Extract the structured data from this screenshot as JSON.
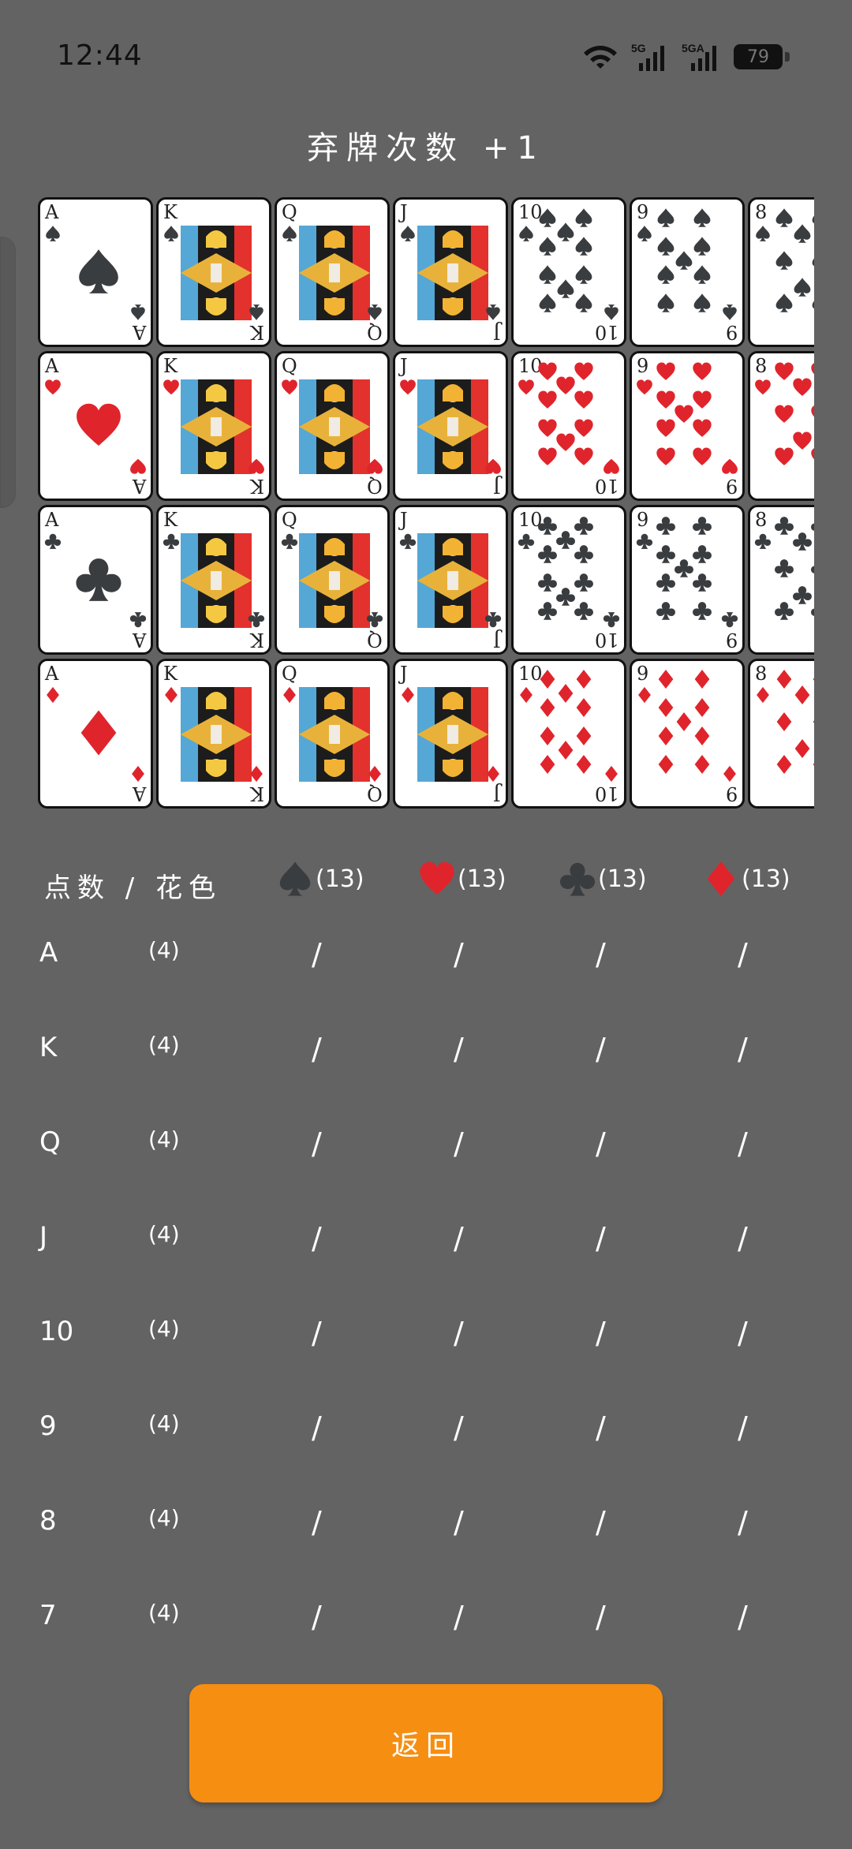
{
  "status": {
    "time": "12:44",
    "battery": "79",
    "network_1": "5G",
    "network_2": "5GA"
  },
  "title": "弃牌次数 +1",
  "cards": {
    "ranks": [
      "A",
      "K",
      "Q",
      "J",
      "10",
      "9",
      "8"
    ],
    "suits": [
      "spade",
      "heart",
      "club",
      "diamond"
    ]
  },
  "table": {
    "header_label": "点数 / 花色",
    "suit_totals": [
      {
        "suit": "spade",
        "label": "(13)"
      },
      {
        "suit": "heart",
        "label": "(13)"
      },
      {
        "suit": "club",
        "label": "(13)"
      },
      {
        "suit": "diamond",
        "label": "(13)"
      }
    ],
    "rows": [
      {
        "rank": "A",
        "total": "(4)",
        "cells": [
          "/",
          "/",
          "/",
          "/"
        ]
      },
      {
        "rank": "K",
        "total": "(4)",
        "cells": [
          "/",
          "/",
          "/",
          "/"
        ]
      },
      {
        "rank": "Q",
        "total": "(4)",
        "cells": [
          "/",
          "/",
          "/",
          "/"
        ]
      },
      {
        "rank": "J",
        "total": "(4)",
        "cells": [
          "/",
          "/",
          "/",
          "/"
        ]
      },
      {
        "rank": "10",
        "total": "(4)",
        "cells": [
          "/",
          "/",
          "/",
          "/"
        ]
      },
      {
        "rank": "9",
        "total": "(4)",
        "cells": [
          "/",
          "/",
          "/",
          "/"
        ]
      },
      {
        "rank": "8",
        "total": "(4)",
        "cells": [
          "/",
          "/",
          "/",
          "/"
        ]
      },
      {
        "rank": "7",
        "total": "(4)",
        "cells": [
          "/",
          "/",
          "/",
          "/"
        ]
      }
    ]
  },
  "back_button": "返回",
  "colors": {
    "background": "#636363",
    "accent": "#F68E11",
    "red_suit": "#E0242C",
    "black_suit": "#3A3D40"
  }
}
